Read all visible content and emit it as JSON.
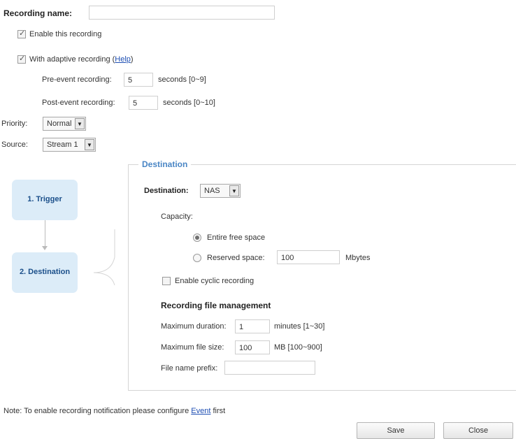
{
  "recording_name": {
    "label": "Recording name:",
    "value": ""
  },
  "enable_recording": {
    "label": "Enable this recording",
    "checked": true
  },
  "adaptive": {
    "label": "With adaptive recording (",
    "help": "Help",
    "close_paren": ")",
    "checked": true
  },
  "pre_event": {
    "label": "Pre-event recording:",
    "value": "5",
    "unit": "seconds [0~9]"
  },
  "post_event": {
    "label": "Post-event recording:",
    "value": "5",
    "unit": "seconds [0~10]"
  },
  "priority": {
    "label": "Priority:",
    "value": "Normal"
  },
  "source": {
    "label": "Source:",
    "value": "Stream 1"
  },
  "flow": {
    "step1": "1.  Trigger",
    "step2": "2.  Destination"
  },
  "destination_panel": {
    "legend": "Destination",
    "destination_label": "Destination:",
    "destination_value": "NAS",
    "capacity_label": "Capacity:",
    "entire_free_space": "Entire free space",
    "reserved_space": "Reserved space:",
    "reserved_value": "100",
    "reserved_unit": "Mbytes",
    "cyclic_label": "Enable cyclic recording",
    "file_mgmt_title": "Recording file management",
    "max_duration_label": "Maximum duration:",
    "max_duration_value": "1",
    "max_duration_unit": "minutes [1~30]",
    "max_size_label": "Maximum file size:",
    "max_size_value": "100",
    "max_size_unit": "MB [100~900]",
    "prefix_label": "File name prefix:",
    "prefix_value": ""
  },
  "note": {
    "text": "Note: To enable recording notification please configure ",
    "link": "Event",
    "suffix": " first"
  },
  "buttons": {
    "save": "Save",
    "close": "Close"
  },
  "selected_capacity": "entire",
  "colors": {
    "accent": "#4a86c5",
    "flow_box": "#dcecf8"
  }
}
